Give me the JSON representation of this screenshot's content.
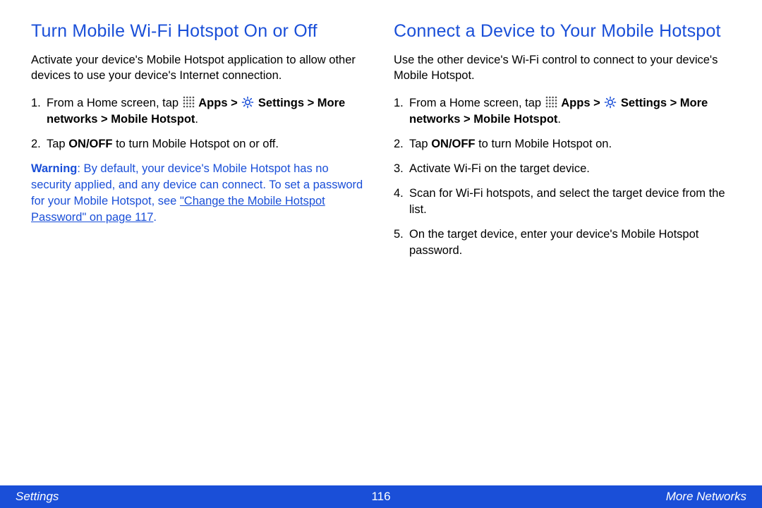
{
  "left": {
    "heading": "Turn Mobile Wi-Fi Hotspot On or Off",
    "intro": "Activate your device's Mobile Hotspot application to allow other devices to use your device's Internet connection.",
    "step1_prefix": "From a Home screen, tap ",
    "apps_label": "Apps > ",
    "settings_label": "Settings > More networks > Mobile Hotspot",
    "step1_suffix": ".",
    "step2_a": "Tap ",
    "step2_b": "ON/OFF",
    "step2_c": " to turn Mobile Hotspot on or off.",
    "warning_label": "Warning",
    "warning_text": ": By default, your device's Mobile Hotspot has no security applied, and any device can connect. To set a password for your Mobile Hotspot, see ",
    "xref": "\"Change the Mobile Hotspot Password\" on page 117",
    "warning_suffix": "."
  },
  "right": {
    "heading": "Connect a Device to Your Mobile Hotspot",
    "intro": "Use the other device's Wi-Fi control to connect to your device's Mobile Hotspot.",
    "step1_prefix": "From a Home screen, tap ",
    "apps_label": "Apps > ",
    "settings_label": "Settings > More networks > Mobile Hotspot",
    "step1_suffix": ".",
    "step2_a": "Tap ",
    "step2_b": "ON/OFF",
    "step2_c": " to turn Mobile Hotspot on.",
    "step3": "Activate Wi-Fi on the target device.",
    "step4": "Scan for Wi-Fi hotspots, and select the target device from the list.",
    "step5": "On the target device, enter your device's Mobile Hotspot password."
  },
  "footer": {
    "left": "Settings",
    "center": "116",
    "right": "More Networks"
  }
}
